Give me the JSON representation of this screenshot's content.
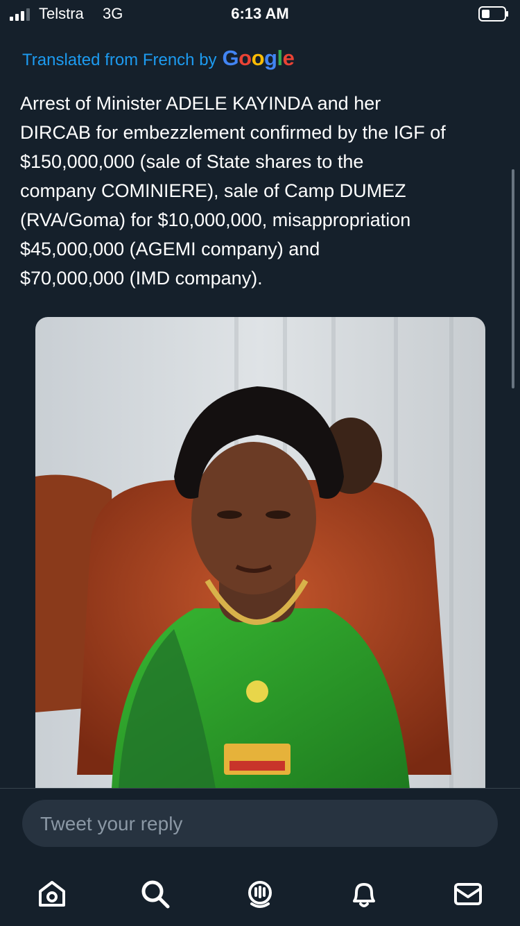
{
  "status_bar": {
    "carrier": "Telstra",
    "network": "3G",
    "time": "6:13 AM",
    "signal_bars": 4,
    "signal_bars_filled": 3
  },
  "translation": {
    "prefix": "Translated from French by",
    "provider_logo_text": "Google",
    "link_color": "#1d9bf0"
  },
  "tweet": {
    "text": "Arrest of Minister ADELE KAYINDA and her\nDIRCAB for embezzlement confirmed by the IGF of\n$150,000,000 (sale of State shares to the\ncompany COMINIERE), sale of Camp DUMEZ\n(RVA/Goma) for $10,000,000, misappropriation\n$45,000,000 (AGEMI company) and\n$70,000,000 (IMD company)."
  },
  "reply": {
    "placeholder": "Tweet your reply"
  },
  "tabbar": {
    "items": [
      {
        "icon": "home-icon"
      },
      {
        "icon": "search-icon"
      },
      {
        "icon": "spaces-icon"
      },
      {
        "icon": "notifications-bell-icon"
      },
      {
        "icon": "messages-envelope-icon"
      }
    ]
  },
  "colors": {
    "background": "#15202b",
    "accent": "#1d9bf0",
    "muted_text": "#8b98a5",
    "reply_box": "#273340"
  }
}
